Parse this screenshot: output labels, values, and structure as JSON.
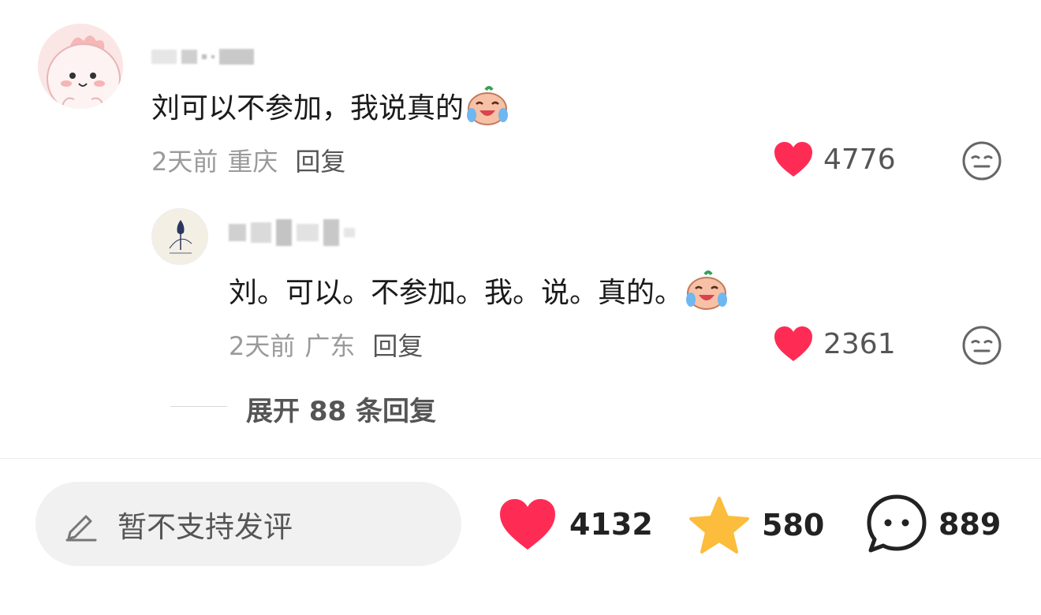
{
  "comment": {
    "text": "刘可以不参加，我说真的",
    "emoji": "crying-laughing-peach-emoji",
    "time": "2天前",
    "location": "重庆",
    "reply_label": "回复",
    "likes": "4776"
  },
  "reply": {
    "text": "刘。可以。不参加。我。说。真的。",
    "emoji": "crying-laughing-peach-emoji",
    "time": "2天前",
    "location": "广东",
    "reply_label": "回复",
    "likes": "2361"
  },
  "expand": {
    "label": "展开 88 条回复"
  },
  "bottom_bar": {
    "input_placeholder": "暂不支持发评",
    "like_count": "4132",
    "favorite_count": "580",
    "comment_count": "889"
  },
  "colors": {
    "heart": "#fe2c55",
    "star": "#fcbc3c",
    "meta_gray": "#9a9a9a"
  }
}
